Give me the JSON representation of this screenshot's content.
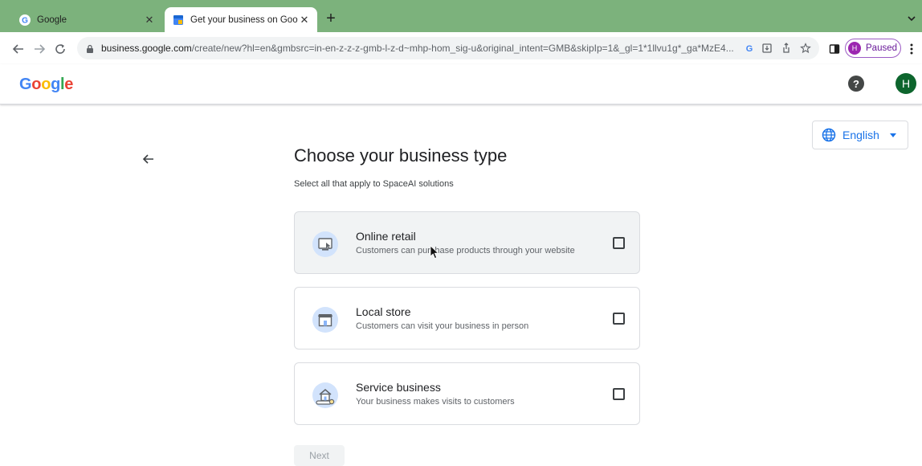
{
  "browser": {
    "tabs": [
      {
        "title": "Google",
        "active": false
      },
      {
        "title": "Get your business on Google",
        "active": true
      }
    ],
    "new_tab": "+",
    "url_host": "business.google.com",
    "url_path": "/create/new?hl=en&gmbsrc=in-en-z-z-z-gmb-l-z-d~mhp-hom_sig-u&original_intent=GMB&skipIp=1&_gl=1*1llvu1g*_ga*MzE4...",
    "profile_initial": "H",
    "profile_status": "Paused"
  },
  "header": {
    "logo_letters": [
      {
        "ch": "G",
        "color": "#4285f4"
      },
      {
        "ch": "o",
        "color": "#ea4335"
      },
      {
        "ch": "o",
        "color": "#fbbc05"
      },
      {
        "ch": "g",
        "color": "#4285f4"
      },
      {
        "ch": "l",
        "color": "#34a853"
      },
      {
        "ch": "e",
        "color": "#ea4335"
      }
    ],
    "help_symbol": "?",
    "avatar_initial": "H"
  },
  "language": {
    "label": "English"
  },
  "page": {
    "title": "Choose your business type",
    "subtitle": "Select all that apply to SpaceAI solutions"
  },
  "options": [
    {
      "name": "Online retail",
      "description": "Customers can purchase products through your website",
      "icon": "monitor-icon",
      "checked": false
    },
    {
      "name": "Local store",
      "description": "Customers can visit your business in person",
      "icon": "storefront-icon",
      "checked": false
    },
    {
      "name": "Service business",
      "description": "Your business makes visits to customers",
      "icon": "house-map-icon",
      "checked": false
    }
  ],
  "next_label": "Next",
  "colors": {
    "accent": "#1a73e8",
    "tab_strip": "#7cb27c"
  }
}
